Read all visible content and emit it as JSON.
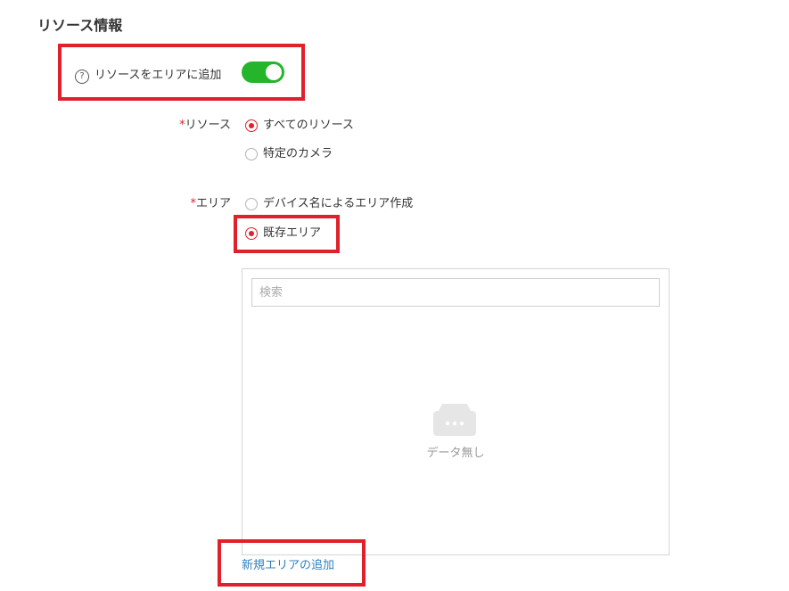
{
  "section": {
    "title": "リソース情報"
  },
  "add_to_area": {
    "help_glyph": "?",
    "label": "リソースをエリアに追加",
    "toggle_on": true,
    "toggle_color": "#25b52b"
  },
  "resource_field": {
    "required_mark": "*",
    "label": "リソース",
    "options": [
      {
        "label": "すべてのリソース",
        "checked": true
      },
      {
        "label": "特定のカメラ",
        "checked": false
      }
    ]
  },
  "area_field": {
    "required_mark": "*",
    "label": "エリア",
    "options": [
      {
        "label": "デバイス名によるエリア作成",
        "checked": false
      },
      {
        "label": "既存エリア",
        "checked": true
      }
    ]
  },
  "area_panel": {
    "search_placeholder": "検索",
    "search_value": "",
    "empty_text": "データ無し"
  },
  "add_new_area_link": "新規エリアの追加",
  "colors": {
    "highlight": "#e0202a",
    "accent_red": "#e0202a",
    "link": "#2d7fc1"
  }
}
